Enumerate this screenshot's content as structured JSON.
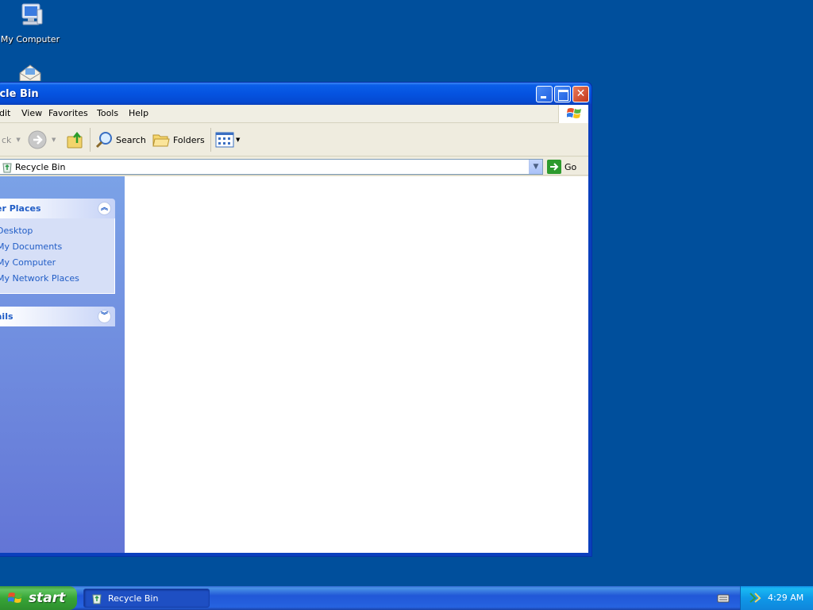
{
  "desktop": {
    "icons": [
      {
        "label": "My Computer",
        "icon": "my-computer-icon"
      },
      {
        "label": "",
        "icon": "envelope-icon"
      }
    ]
  },
  "window": {
    "title": "Recycle Bin",
    "title_visible": "ycle Bin",
    "buttons": {
      "minimize": "minimize",
      "maximize": "maximize",
      "close": "close"
    }
  },
  "menubar": {
    "items": [
      "Edit",
      "View",
      "Favorites",
      "Tools",
      "Help"
    ],
    "edit_visible": "dit"
  },
  "toolbar": {
    "back_label": "ck",
    "search_label": "Search",
    "folders_label": "Folders"
  },
  "address": {
    "value": "Recycle Bin",
    "go_label": "Go"
  },
  "taskpane": {
    "other_places": {
      "title": "er Places",
      "links": [
        "Desktop",
        "My Documents",
        "My Computer",
        "My Network Places"
      ]
    },
    "details": {
      "title": "ails"
    }
  },
  "taskbar": {
    "start_label": "start",
    "task_button_label": "Recycle Bin",
    "clock": "4:29 AM"
  },
  "colors": {
    "desktop": "#004f9c",
    "titlebar": "#0553e0",
    "taskpane_link": "#215dc6",
    "start_green": "#37a537"
  }
}
